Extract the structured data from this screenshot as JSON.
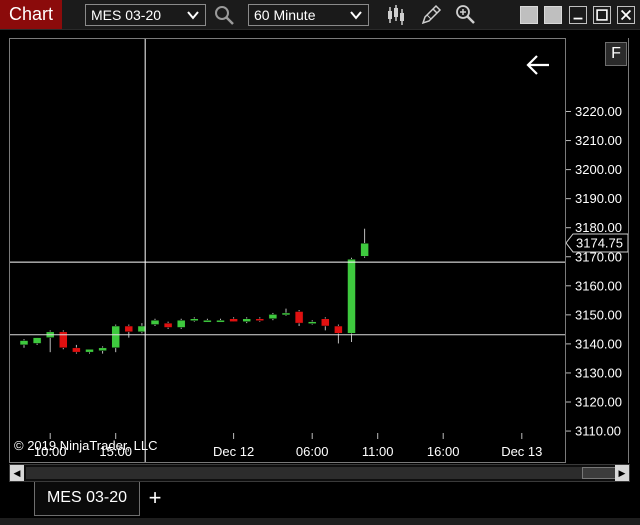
{
  "toolbar": {
    "title": "Chart",
    "instrument": "MES 03-20",
    "interval": "60 Minute",
    "tools": [
      "bar-type-icon",
      "drawing-tool-icon",
      "zoom-icon"
    ],
    "window_buttons": [
      "minimize-icon",
      "maximize-icon",
      "close-icon"
    ]
  },
  "chart": {
    "f_button": "F",
    "copyright": "© 2019 NinjaTrader, LLC",
    "last_price_label": "3174.75"
  },
  "colors": {
    "up_candle": "#3ec93e",
    "down_candle": "#e01010",
    "title_bg": "#8b0b0b",
    "background": "#000000",
    "crosshair": "#ffffff"
  },
  "chart_data": {
    "type": "candlestick",
    "title": "",
    "xlabel": "",
    "ylabel": "",
    "ylim": [
      3103.5,
      3225.5
    ],
    "price_ticks": [
      3220,
      3210,
      3200,
      3190,
      3180,
      3170,
      3160,
      3150,
      3140,
      3130,
      3120,
      3110
    ],
    "price_tick_labels": [
      "3220.00",
      "3210.00",
      "3200.00",
      "3190.00",
      "3180.00",
      "3170.00",
      "3160.00",
      "3150.00",
      "3140.00",
      "3130.00",
      "3120.00",
      "3110.00"
    ],
    "time_labels": [
      "10:00",
      "15:00",
      "Dec 12",
      "06:00",
      "11:00",
      "16:00",
      "Dec 13"
    ],
    "time_label_bar_index": [
      2,
      7,
      16,
      22,
      27,
      32,
      38
    ],
    "last_price": 3174.75,
    "crosshair": {
      "price": 3168.5,
      "bar_index": 9.25
    },
    "price_line": 3143.5,
    "bars": [
      {
        "o": 3140.0,
        "h": 3142.0,
        "l": 3139.0,
        "c": 3141.5
      },
      {
        "o": 3140.5,
        "h": 3142.5,
        "l": 3140.0,
        "c": 3142.5
      },
      {
        "o": 3142.5,
        "h": 3145.0,
        "l": 3137.5,
        "c": 3144.5
      },
      {
        "o": 3144.5,
        "h": 3145.0,
        "l": 3138.5,
        "c": 3139.0
      },
      {
        "o": 3139.0,
        "h": 3140.0,
        "l": 3137.0,
        "c": 3137.5
      },
      {
        "o": 3137.5,
        "h": 3138.5,
        "l": 3137.0,
        "c": 3138.5
      },
      {
        "o": 3138.0,
        "h": 3139.5,
        "l": 3137.0,
        "c": 3139.0
      },
      {
        "o": 3139.0,
        "h": 3147.0,
        "l": 3137.5,
        "c": 3146.5
      },
      {
        "o": 3146.5,
        "h": 3147.0,
        "l": 3142.5,
        "c": 3144.5
      },
      {
        "o": 3144.5,
        "h": 3147.5,
        "l": 3144.0,
        "c": 3146.5
      },
      {
        "o": 3147.0,
        "h": 3149.0,
        "l": 3146.5,
        "c": 3148.5
      },
      {
        "o": 3147.5,
        "h": 3148.0,
        "l": 3145.5,
        "c": 3146.0
      },
      {
        "o": 3146.0,
        "h": 3149.0,
        "l": 3145.5,
        "c": 3148.5
      },
      {
        "o": 3148.5,
        "h": 3149.5,
        "l": 3148.0,
        "c": 3149.0
      },
      {
        "o": 3148.5,
        "h": 3149.0,
        "l": 3148.0,
        "c": 3148.5
      },
      {
        "o": 3148.5,
        "h": 3149.0,
        "l": 3148.0,
        "c": 3148.5
      },
      {
        "o": 3149.0,
        "h": 3149.5,
        "l": 3148.0,
        "c": 3148.0
      },
      {
        "o": 3148.0,
        "h": 3149.5,
        "l": 3147.5,
        "c": 3149.0
      },
      {
        "o": 3149.0,
        "h": 3149.5,
        "l": 3148.0,
        "c": 3148.5
      },
      {
        "o": 3149.0,
        "h": 3151.0,
        "l": 3148.5,
        "c": 3150.5
      },
      {
        "o": 3150.5,
        "h": 3152.5,
        "l": 3150.0,
        "c": 3151.0
      },
      {
        "o": 3151.5,
        "h": 3152.0,
        "l": 3146.5,
        "c": 3147.5
      },
      {
        "o": 3147.5,
        "h": 3148.5,
        "l": 3147.0,
        "c": 3148.0
      },
      {
        "o": 3149.0,
        "h": 3149.5,
        "l": 3145.0,
        "c": 3146.5
      },
      {
        "o": 3146.5,
        "h": 3147.0,
        "l": 3140.5,
        "c": 3144.0
      },
      {
        "o": 3144.0,
        "h": 3170.0,
        "l": 3141.0,
        "c": 3169.5
      },
      {
        "o": 3170.5,
        "h": 3180.0,
        "l": 3170.0,
        "c": 3175.0
      }
    ]
  },
  "scrollbar": {
    "left_arrow": "◀",
    "right_arrow": "▶"
  },
  "tabs": {
    "items": [
      {
        "label": "MES 03-20"
      }
    ],
    "add_label": "+"
  }
}
